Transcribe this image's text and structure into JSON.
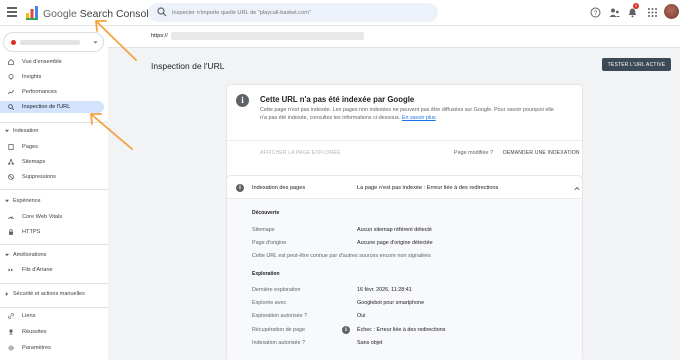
{
  "header": {
    "app_name_prefix": "Google",
    "app_name": "Search Console",
    "search_placeholder": "Inspecter n'importe quelle URL de \"playcall-basket.com\"",
    "notification_count": "9"
  },
  "sidebar": {
    "top_items": [
      {
        "label": "Vue d'ensemble"
      },
      {
        "label": "Insights"
      },
      {
        "label": "Performances"
      },
      {
        "label": "Inspection de l'URL"
      }
    ],
    "sections": [
      {
        "title": "Indexation",
        "items": [
          {
            "label": "Pages"
          },
          {
            "label": "Sitemaps"
          },
          {
            "label": "Suppressions"
          }
        ]
      },
      {
        "title": "Expérience",
        "items": [
          {
            "label": "Core Web Vitals"
          },
          {
            "label": "HTTPS"
          }
        ]
      },
      {
        "title": "Améliorations",
        "items": [
          {
            "label": "Fils d'Ariane"
          }
        ]
      },
      {
        "title": "Sécurité et actions manuelles",
        "items": []
      }
    ],
    "bottom_items": [
      {
        "label": "Liens"
      },
      {
        "label": "Réussites"
      },
      {
        "label": "Paramètres"
      }
    ]
  },
  "urlbar": {
    "prefix": "https://"
  },
  "main": {
    "page_title": "Inspection de l'URL",
    "test_button": "TESTER L'URL ACTIVE"
  },
  "status_card": {
    "title": "Cette URL n'a pas été indexée par Google",
    "description": "Cette page n'est pas indexée. Les pages non indexées ne peuvent pas être diffusées sur Google. Pour savoir pourquoi elle n'a pas été indexée, consultez les informations ci-dessous.",
    "learn_more": "En savoir plus",
    "view_page": "AFFICHER LA PAGE EXPLORÉE",
    "modified_question": "Page modifiée ?",
    "request_indexing": "DEMANDER UNE INDEXATION"
  },
  "indexing_card": {
    "label": "Indexation des pages",
    "value": "La page n'est pas indexée : Erreur liée à des redirections",
    "discovery": {
      "title": "Découverte",
      "rows": [
        {
          "label": "Sitemaps",
          "value": "Aucun sitemap référent détecté"
        },
        {
          "label": "Page d'origine",
          "value": "Aucune page d'origine détectée"
        }
      ],
      "note": "Cette URL est peut-être connue par d'autres sources encore non signalées"
    },
    "crawl": {
      "title": "Exploration",
      "rows": [
        {
          "label": "Dernière exploration",
          "value": "16 févr. 2026, 11:28:41"
        },
        {
          "label": "Explorée avec",
          "value": "Googlebot pour smartphone"
        },
        {
          "label": "Exploration autorisée ?",
          "value": "Oui"
        },
        {
          "label": "Récupération de page",
          "value": "Échec : Erreur liée à des redirections"
        },
        {
          "label": "Indexation autorisée ?",
          "value": "Sans objet"
        }
      ]
    }
  },
  "colors": {
    "accent": "#0b57d0",
    "active_bg": "#d3e3fd",
    "annotation_arrow": "#f4a340",
    "button_dark": "#3c4a57"
  }
}
